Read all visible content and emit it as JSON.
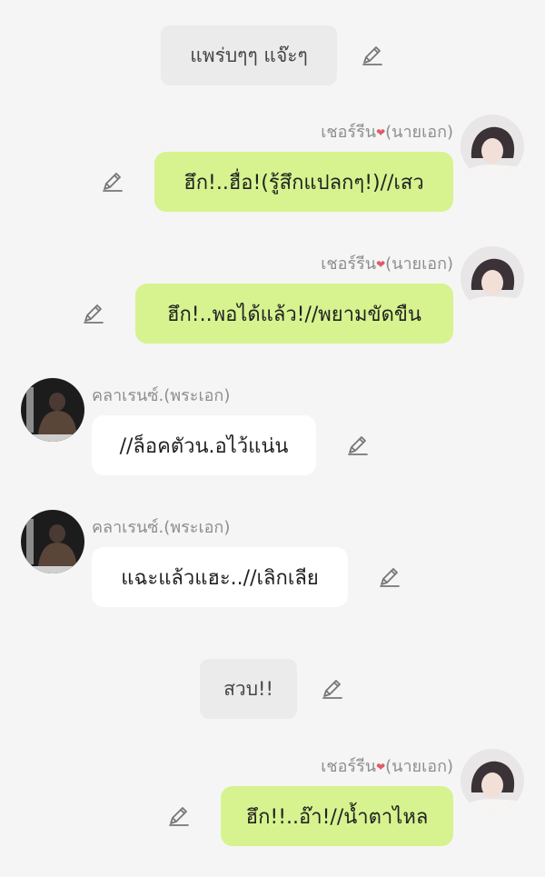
{
  "messages": [
    {
      "type": "narration",
      "text": "แพร่บๆๆ แจ๊ะๆ"
    },
    {
      "type": "message",
      "side": "right",
      "name": "เชอร์รีน",
      "role": "(นายเอก)",
      "text": "ฮึก!..ฮื่อ!(รู้สึกแปลกๆ!)//เสว"
    },
    {
      "type": "message",
      "side": "right",
      "name": "เชอร์รีน",
      "role": "(นายเอก)",
      "text": "ฮึก!..พอได้แล้ว!//พยามขัดขืน"
    },
    {
      "type": "message",
      "side": "left",
      "name": "คลาเรนซ์.(พระเอก)",
      "text": "//ล็อคตัวน.อไว้แน่น"
    },
    {
      "type": "message",
      "side": "left",
      "name": "คลาเรนซ์.(พระเอก)",
      "text": "แฉะแล้วแฮะ..//เลิกเลีย"
    },
    {
      "type": "narration",
      "text": "สวบ!!"
    },
    {
      "type": "message",
      "side": "right",
      "name": "เชอร์รีน",
      "role": "(นายเอก)",
      "text": "ฮึก!!..อ๊า!//น้ำตาไหล"
    }
  ],
  "colors": {
    "background": "#f5f5f5",
    "right_bubble": "#d6f38f",
    "left_bubble": "#ffffff",
    "narration_bubble": "#ebebeb"
  },
  "icons": {
    "edit": "pencil-icon",
    "name_decoration": "heart-icon"
  }
}
